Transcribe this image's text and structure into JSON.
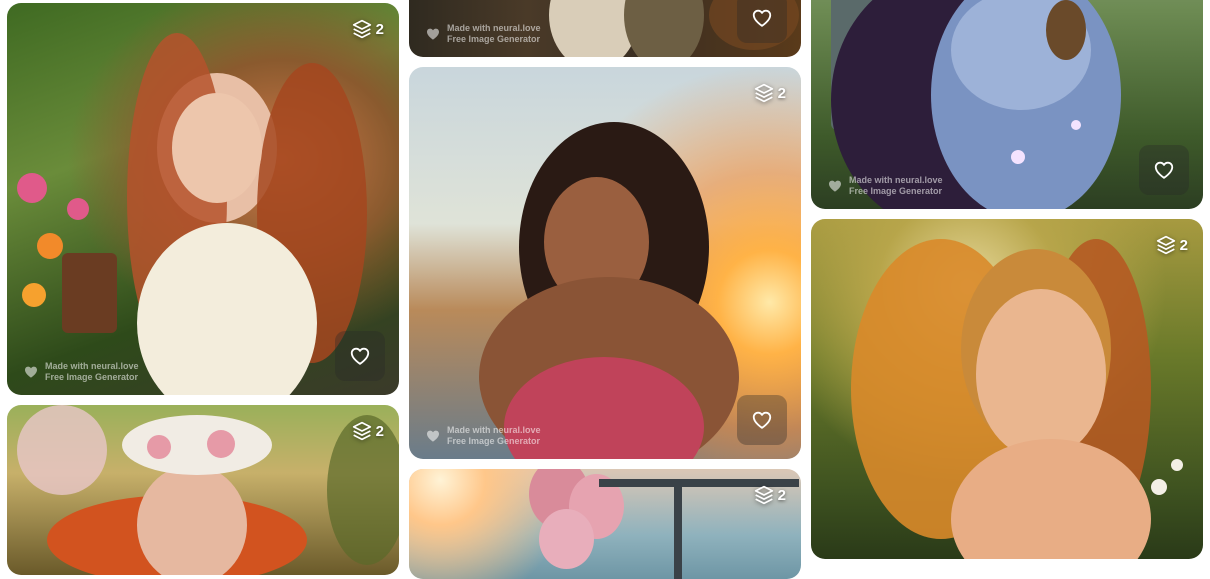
{
  "gallery": {
    "cards": [
      {
        "id": "c1",
        "badge_count": "2",
        "watermark_line1": "Made with neural.love",
        "watermark_line2": "Free Image Generator",
        "subject": "red-haired woman holding a book in a flower garden"
      },
      {
        "id": "c2",
        "badge_count": "2",
        "subject": "woman with flower crown and flowing red hair"
      },
      {
        "id": "c3",
        "watermark_line1": "Made with neural.love",
        "watermark_line2": "Free Image Generator",
        "subject": "couple in lace dress"
      },
      {
        "id": "c4",
        "badge_count": "2",
        "watermark_line1": "Made with neural.love",
        "watermark_line2": "Free Image Generator",
        "subject": "smiling curly-haired woman at sunset by the sea"
      },
      {
        "id": "c5",
        "badge_count": "2",
        "subject": "room with pink balloons and confetti"
      },
      {
        "id": "c6",
        "watermark_line1": "Made with neural.love",
        "watermark_line2": "Free Image Generator",
        "subject": "fantasy sorceress in blue gown with magic sparkles"
      },
      {
        "id": "c7",
        "badge_count": "2",
        "subject": "freckled smiling woman with golden hair in a field"
      }
    ]
  },
  "icons": {
    "badge": "layers-icon",
    "favorite": "heart-outline-icon",
    "watermark": "heart-logo-icon"
  },
  "colors": {
    "background": "#ffffff",
    "badge_text": "#ffffff"
  }
}
